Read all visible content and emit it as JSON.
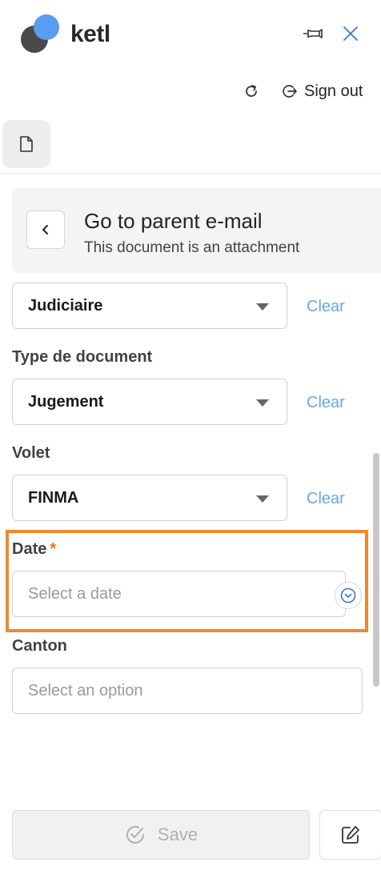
{
  "header": {
    "brand": "ketl",
    "pin_icon": "pin-icon",
    "close_icon": "close-icon"
  },
  "toolbar": {
    "refresh_icon": "refresh-icon",
    "sign_out_label": "Sign out"
  },
  "tabs": {
    "document_icon": "document-icon"
  },
  "parent_email": {
    "title": "Go to parent e-mail",
    "subtitle": "This document is an attachment"
  },
  "fields": {
    "category": {
      "value": "Judiciaire",
      "clear": "Clear"
    },
    "document_type": {
      "label": "Type de document",
      "value": "Jugement",
      "clear": "Clear"
    },
    "volet": {
      "label": "Volet",
      "value": "FINMA",
      "clear": "Clear"
    },
    "date": {
      "label": "Date",
      "required_mark": "*",
      "placeholder": "Select a date"
    },
    "canton": {
      "label": "Canton",
      "placeholder": "Select an option"
    }
  },
  "actions": {
    "save_label": "Save",
    "edit_icon": "edit-icon"
  },
  "colors": {
    "accent": "#5b9bf0",
    "link": "#6aa8e8",
    "highlight": "#f0882c",
    "required": "#e8742a"
  }
}
